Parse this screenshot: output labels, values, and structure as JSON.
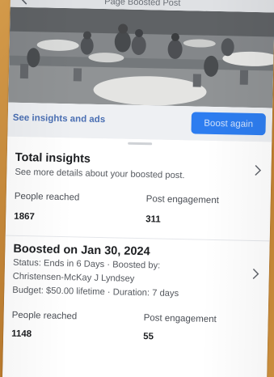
{
  "app": {
    "title": "Page Boosted Post"
  },
  "actions": {
    "see_insights_label": "See insights and ads",
    "boost_again_label": "Boost again"
  },
  "total_insights": {
    "title": "Total insights",
    "subtitle": "See more details about your boosted post.",
    "people_reached_label": "People reached",
    "people_reached_value": "1867",
    "post_engagement_label": "Post engagement",
    "post_engagement_value": "311"
  },
  "boost": {
    "title": "Boosted on Jan 30, 2024",
    "status_line": "Status: Ends in 6 Days · Boosted by:",
    "boosted_by": "Christensen-McKay J Lyndsey",
    "budget_line": "Budget: $50.00 lifetime · Duration: 7 days",
    "people_reached_label": "People reached",
    "people_reached_value": "1148",
    "post_engagement_label": "Post engagement",
    "post_engagement_value": "55"
  },
  "colors": {
    "accent": "#2d7df0",
    "link": "#4a6fb3",
    "frame": "#c88f3f"
  },
  "icons": {
    "back": "back-arrow-icon",
    "chevron": "chevron-right-icon"
  }
}
